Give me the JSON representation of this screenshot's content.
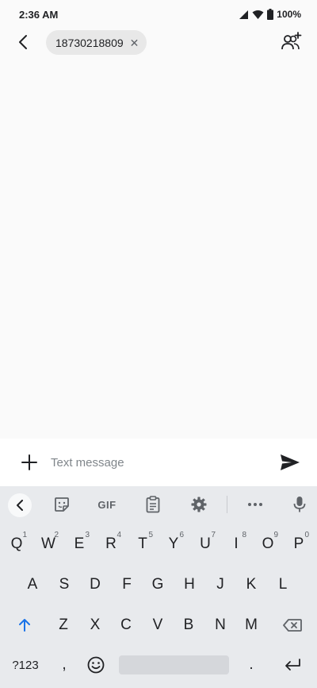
{
  "status_bar": {
    "time": "2:36 AM",
    "battery_level": "100%",
    "icons": [
      "signal-icon",
      "wifi-icon",
      "battery-icon"
    ]
  },
  "header": {
    "recipient": "18730218809",
    "chip_close_icon": "close-icon",
    "add_people_icon": "add-people-icon",
    "back_icon": "back-arrow-icon"
  },
  "compose": {
    "placeholder": "Text message",
    "attach_icon": "plus-icon",
    "send_icon": "send-icon"
  },
  "keyboard": {
    "toolbar": {
      "collapse_icon": "chevron-left-icon",
      "sticker_icon": "sticker-icon",
      "gif_label": "GIF",
      "clipboard_icon": "clipboard-icon",
      "settings_icon": "gear-icon",
      "more_icon": "more-icon",
      "mic_icon": "mic-icon"
    },
    "row1": [
      {
        "label": "Q",
        "hint": "1"
      },
      {
        "label": "W",
        "hint": "2"
      },
      {
        "label": "E",
        "hint": "3"
      },
      {
        "label": "R",
        "hint": "4"
      },
      {
        "label": "T",
        "hint": "5"
      },
      {
        "label": "Y",
        "hint": "6"
      },
      {
        "label": "U",
        "hint": "7"
      },
      {
        "label": "I",
        "hint": "8"
      },
      {
        "label": "O",
        "hint": "9"
      },
      {
        "label": "P",
        "hint": "0"
      }
    ],
    "row2": [
      "A",
      "S",
      "D",
      "F",
      "G",
      "H",
      "J",
      "K",
      "L"
    ],
    "row3": [
      "Z",
      "X",
      "C",
      "V",
      "B",
      "N",
      "M"
    ],
    "bottom": {
      "symbols_label": "?123",
      "comma_label": ",",
      "period_label": ".",
      "emoji_icon": "emoji-icon",
      "enter_icon": "enter-icon",
      "shift_icon": "shift-icon",
      "backspace_icon": "backspace-icon"
    },
    "accent_color": "#1a73e8"
  }
}
